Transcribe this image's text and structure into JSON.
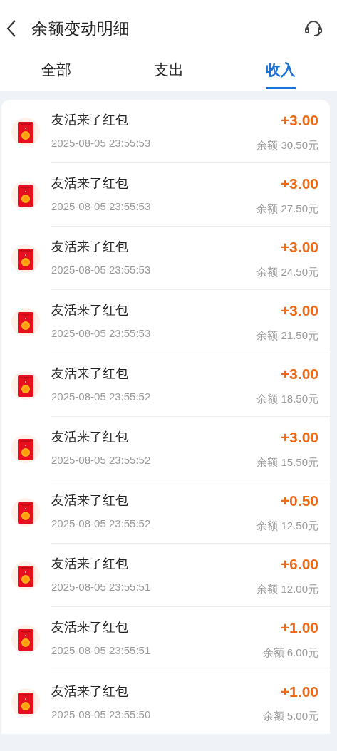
{
  "header": {
    "title": "余额变动明细"
  },
  "tabs": [
    {
      "label": "全部",
      "selected": false
    },
    {
      "label": "支出",
      "selected": false
    },
    {
      "label": "收入",
      "selected": true
    }
  ],
  "records": [
    {
      "title": "友活来了红包",
      "time": "2025-08-05 23:55:53",
      "amount": "+3.00",
      "balance": "余额 30.50元"
    },
    {
      "title": "友活来了红包",
      "time": "2025-08-05 23:55:53",
      "amount": "+3.00",
      "balance": "余额 27.50元"
    },
    {
      "title": "友活来了红包",
      "time": "2025-08-05 23:55:53",
      "amount": "+3.00",
      "balance": "余额 24.50元"
    },
    {
      "title": "友活来了红包",
      "time": "2025-08-05 23:55:53",
      "amount": "+3.00",
      "balance": "余额 21.50元"
    },
    {
      "title": "友活来了红包",
      "time": "2025-08-05 23:55:52",
      "amount": "+3.00",
      "balance": "余额 18.50元"
    },
    {
      "title": "友活来了红包",
      "time": "2025-08-05 23:55:52",
      "amount": "+3.00",
      "balance": "余额 15.50元"
    },
    {
      "title": "友活来了红包",
      "time": "2025-08-05 23:55:52",
      "amount": "+0.50",
      "balance": "余额 12.50元"
    },
    {
      "title": "友活来了红包",
      "time": "2025-08-05 23:55:51",
      "amount": "+6.00",
      "balance": "余额 12.00元"
    },
    {
      "title": "友活来了红包",
      "time": "2025-08-05 23:55:51",
      "amount": "+1.00",
      "balance": "余额 6.00元"
    },
    {
      "title": "友活来了红包",
      "time": "2025-08-05 23:55:50",
      "amount": "+1.00",
      "balance": "余额 5.00元"
    }
  ]
}
